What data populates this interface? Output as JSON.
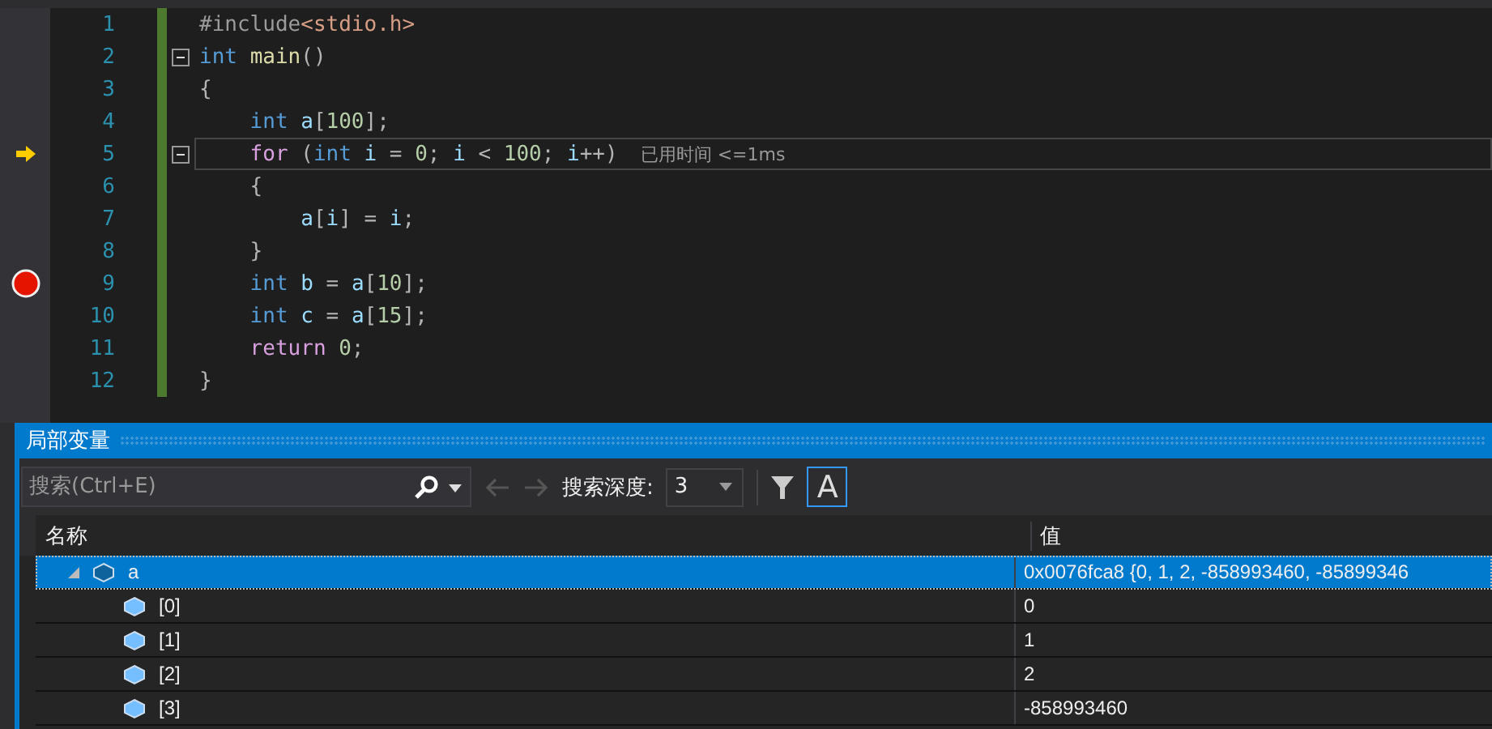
{
  "editor": {
    "lines": [
      {
        "number": "1",
        "fold": false,
        "current": false,
        "breakpoint": false,
        "tokens": [
          {
            "text": "#include",
            "kind": "pre"
          },
          {
            "text": "<stdio.h>",
            "kind": "str"
          }
        ]
      },
      {
        "number": "2",
        "fold": true,
        "current": false,
        "breakpoint": false,
        "tokens": [
          {
            "text": "int ",
            "kind": "kw"
          },
          {
            "text": "main",
            "kind": "fn"
          },
          {
            "text": "()",
            "kind": "p"
          }
        ]
      },
      {
        "number": "3",
        "fold": false,
        "current": false,
        "breakpoint": false,
        "tokens": [
          {
            "text": "{",
            "kind": "p"
          }
        ]
      },
      {
        "number": "4",
        "fold": false,
        "current": false,
        "breakpoint": false,
        "tokens": [
          {
            "text": "    int ",
            "kind": "kw"
          },
          {
            "text": "a",
            "kind": "id"
          },
          {
            "text": "[",
            "kind": "p"
          },
          {
            "text": "100",
            "kind": "num"
          },
          {
            "text": "];",
            "kind": "p"
          }
        ]
      },
      {
        "number": "5",
        "fold": true,
        "current": true,
        "breakpoint": false,
        "tip": "已用时间 <=1ms",
        "tokens": [
          {
            "text": "    for",
            "kind": "ctl"
          },
          {
            "text": " (",
            "kind": "p"
          },
          {
            "text": "int ",
            "kind": "kw"
          },
          {
            "text": "i",
            "kind": "id"
          },
          {
            "text": " = ",
            "kind": "p"
          },
          {
            "text": "0",
            "kind": "num"
          },
          {
            "text": "; ",
            "kind": "p"
          },
          {
            "text": "i",
            "kind": "id"
          },
          {
            "text": " < ",
            "kind": "p"
          },
          {
            "text": "100",
            "kind": "num"
          },
          {
            "text": "; ",
            "kind": "p"
          },
          {
            "text": "i",
            "kind": "id"
          },
          {
            "text": "++)",
            "kind": "p"
          }
        ]
      },
      {
        "number": "6",
        "fold": false,
        "current": false,
        "breakpoint": false,
        "tokens": [
          {
            "text": "    {",
            "kind": "p"
          }
        ]
      },
      {
        "number": "7",
        "fold": false,
        "current": false,
        "breakpoint": false,
        "tokens": [
          {
            "text": "        a",
            "kind": "id"
          },
          {
            "text": "[",
            "kind": "p"
          },
          {
            "text": "i",
            "kind": "id"
          },
          {
            "text": "] = ",
            "kind": "p"
          },
          {
            "text": "i",
            "kind": "id"
          },
          {
            "text": ";",
            "kind": "p"
          }
        ]
      },
      {
        "number": "8",
        "fold": false,
        "current": false,
        "breakpoint": false,
        "tokens": [
          {
            "text": "    }",
            "kind": "p"
          }
        ]
      },
      {
        "number": "9",
        "fold": false,
        "current": false,
        "breakpoint": true,
        "tokens": [
          {
            "text": "    int ",
            "kind": "kw"
          },
          {
            "text": "b",
            "kind": "id"
          },
          {
            "text": " = ",
            "kind": "p"
          },
          {
            "text": "a",
            "kind": "id"
          },
          {
            "text": "[",
            "kind": "p"
          },
          {
            "text": "10",
            "kind": "num"
          },
          {
            "text": "];",
            "kind": "p"
          }
        ]
      },
      {
        "number": "10",
        "fold": false,
        "current": false,
        "breakpoint": false,
        "tokens": [
          {
            "text": "    int ",
            "kind": "kw"
          },
          {
            "text": "c",
            "kind": "id"
          },
          {
            "text": " = ",
            "kind": "p"
          },
          {
            "text": "a",
            "kind": "id"
          },
          {
            "text": "[",
            "kind": "p"
          },
          {
            "text": "15",
            "kind": "num"
          },
          {
            "text": "];",
            "kind": "p"
          }
        ]
      },
      {
        "number": "11",
        "fold": false,
        "current": false,
        "breakpoint": false,
        "tokens": [
          {
            "text": "    return ",
            "kind": "ctl"
          },
          {
            "text": "0",
            "kind": "num"
          },
          {
            "text": ";",
            "kind": "p"
          }
        ]
      },
      {
        "number": "12",
        "fold": false,
        "current": false,
        "breakpoint": false,
        "tokens": [
          {
            "text": "}",
            "kind": "p"
          }
        ]
      }
    ]
  },
  "locals": {
    "title": "局部变量",
    "search": {
      "placeholder": "搜索(Ctrl+E)"
    },
    "depth_label": "搜索深度:",
    "depth": "3",
    "case_toggle": {
      "label": "A",
      "selected": true
    },
    "columns": [
      "名称",
      "值"
    ],
    "rows": [
      {
        "name": "a",
        "value": "0x0076fca8 {0, 1, 2, -858993460, -85899346",
        "expanded": true,
        "selected": true,
        "children": [
          {
            "name": "[0]",
            "value": "0",
            "selected": false
          },
          {
            "name": "[1]",
            "value": "1",
            "selected": false
          },
          {
            "name": "[2]",
            "value": "2",
            "selected": false
          },
          {
            "name": "[3]",
            "value": "-858993460",
            "selected": false
          }
        ]
      }
    ]
  }
}
